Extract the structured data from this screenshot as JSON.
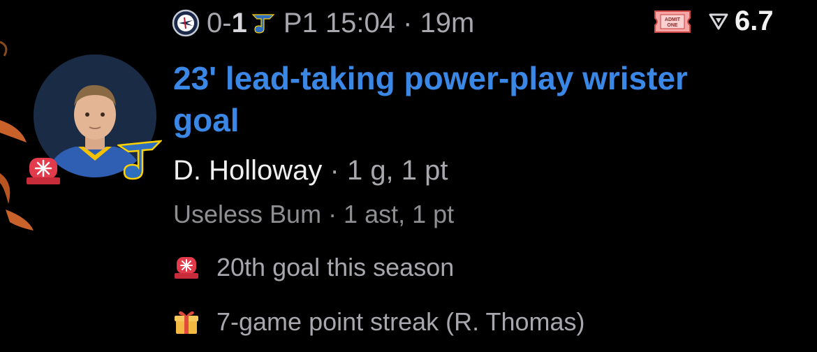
{
  "header": {
    "score_prefix": "0-",
    "score_bold": "1",
    "period_time": "P1 15:04 · 19m",
    "ticket_text": "ADMIT ONE",
    "odds": "6.7"
  },
  "event": {
    "title": "23' lead-taking power-play wrister goal",
    "player_name": "D. Holloway",
    "player_stats": " · 1 g, 1 pt",
    "assist": "Useless Bum · 1 ast, 1 pt"
  },
  "notes": [
    {
      "icon": "siren-icon",
      "text": "20th goal this season"
    },
    {
      "icon": "gift-icon",
      "text": "7-game point streak (R. Thomas)"
    }
  ],
  "colors": {
    "title": "#3a87e6",
    "background": "#000000",
    "muted_text": "#a7a7ad",
    "blues_blue": "#2f6fc0"
  }
}
